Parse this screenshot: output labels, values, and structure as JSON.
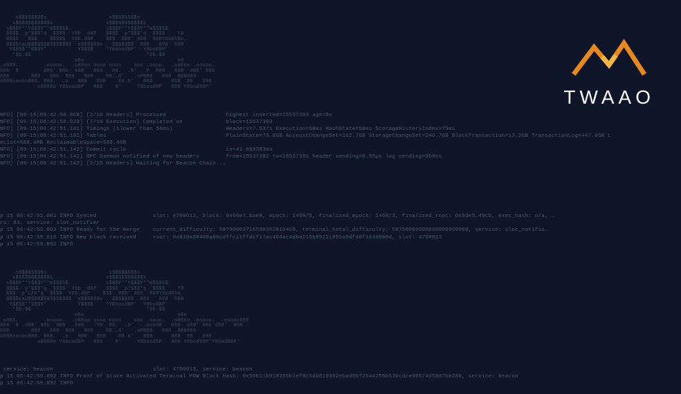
{
  "logo": {
    "text": "TWAAO"
  },
  "ascii": {
    "bear": "     s$$$$$$$$s                    s$$$$$$$$s\n    s$$$$$$$$$$$s                 s$$$$$$$$$$$s\n  s$$$P**Y$$$Y**W$$$S$            s$$$P**Y$$$Y**W$$$S$\n  $$$$  p*$$$*q  $$$$  Y8b  d8P   $$$$  p*$$$*q  $$$$    Y8\n  $$$S   $$$    $$$$$  Y8b.d8P    $$$  8B8' 888  888Y8b888o.\n  $$$DcaU$$$$$$$$$$$$$$  o$$$$$$o   $$$$$$$  888   888  888\n   Y$$$$**$$$Y*          Y$$$$    *Y8bood8P'  Y8bod8P'\n    *Sb.$$                                     *Sb.$$\n                        o8o                              o8\n.o888.        .ooooo.  .o88oo oooo oooo    ooo .oooo.  .o88oo .ooooo.\n888  8        d88' 88b  888   888   88.  .8'   P  888   888  d88' 88b\n888       888   888  888   888    88..8'   .oPB88   888  888888\no888ooooo888. 888.  .o   888   888    88.8'   888      888  88   888\n            o8888o Y8bood8P   888    8'     Y8bood8P   888 Y8bod88P'",
    "bear2": "     s$$$$$$$$s                    s$$$$$$$$s\n    s$$$$$$$$$$$s                 s$$$$$$$$$$$s\n  s$$$P**Y$$$Y**W$$$S$            s$$$P**Y$$$Y**W$$$S$\n  $$$$  p*$$$*q  $$$$  Y8b  d8P   $$$$  p*$$$*q  $$$$    Y8\n  $$$  p*LFG*q  $$$$  Y8b.d8P    $$$  8B8' 888  888Y8b888o.\n  $$$DcaU$$$$$$$$$$$$$$  o$$$$$$o   $$$$$$$  888   888  888\n   Y$$$$**$$$Y*          Y$$$$    *Y8bood8P'  Y8bod8P'\n    *Sb.$$                                     *Sb.$$\n                        o8o                              o8o\n.o888.        .ooooo.  .o88oo oooo oooo    ooo .oooo.  .o88oo .ooooo.  .ooooo888\n888  8 .d88' 88b  888   888   'Y8  88.  .8'   .ooo88   888  d88' 88b d88'  888\n888       888   888  888   888    88..8'   .oPB88   888  888888\no888ooooo888. 888.  .o   888   888    88.8'   888      888  88   888\n            o8888o Y8bood8P   888    8'     Y8bood8P   888 Y8bod88P'Y8bod88P'"
  },
  "logs": {
    "block1": [
      {
        "left": "NFO] [09-15|06:42:50.868] [2/16 Headers] Processed",
        "right": "highest inserted=15537393 age=8s"
      },
      {
        "left": "NFO] [09-15|06:42:50.929] [7/16 Execution] Completed on",
        "right": "block=15537393"
      },
      {
        "left": "NFO] [09-15|06:42:51.101] Timings (slower than 50ms)",
        "right": "Headers=7.537s Execution=58ms HashState=50ms StorageHistoryIndex=79ms"
      },
      {
        "left": "NFO] [09-15|06:42:51.101] Tables",
        "right": "PlainState=73.8GB AccountChangeSet=162.7GB StorageChangeSet=240.7GB BlockTransaction=13.2GB TransactionLog=447.0GB L"
      },
      {
        "left": "eList=588.4MB ReclaimableSpace=588.4GB",
        "right": ""
      },
      {
        "left": "NFO] [09-15|06:42:51.142] Commit cycle",
        "right": "in=41.089383ms"
      },
      {
        "left": "NFO] [09-15|06:42:51.142] RPC Daemon notified of new headers",
        "right": "from=15537392 to=15537393 header sending=8.55µs log sending=350ns"
      },
      {
        "left": "NFO] [09-15|06:42:51.142] [2/16 Headers] Waiting for Beacon Chain...",
        "right": ""
      }
    ],
    "block2": [
      {
        "left": "p 15 06:42:53.001 INFO Synced",
        "right": "slot: 4700012, block: 0x60e7…bae8, epoch: 146875, finalized_epoch: 146873, finalized_root: 0x9de5…49cb, exec_hash: n/a, …"
      },
      {
        "left": "rs: 83, service: slot_notifier",
        "right": ""
      },
      {
        "left": "p 15 06:42:53.003 INFO Ready for the merge",
        "right": "current_difficulty: 58750003716598352816469, terminal_total_difficulty: 58750000000000000000000, service: slot_notifie…"
      },
      {
        "left": "p 15 06:42:59.616 INFO New block received",
        "right": "root: 0x810a00400a80cdffc11ffdcf17ac404ac4dba215b95221955a9dfddf163d0b0d, slot: 4700013"
      },
      {
        "left": "p 15 06:42:59.892 INFO",
        "right": ""
      }
    ],
    "block3": [
      {
        "left": " service: beacon",
        "right": "slot: 4700013, service: beacon"
      },
      {
        "left": "p 15 06:42:59.892 INFO Proof of Stake Activated",
        "right": "Terminal POW Block Hash: 0x55b11b918355b1ef9c5db810302ebad0bf2544255b530cdce90674d5887bb286, service: beacon"
      },
      {
        "left": "p 15 06:42:59.892 INFO",
        "right": ""
      }
    ]
  }
}
